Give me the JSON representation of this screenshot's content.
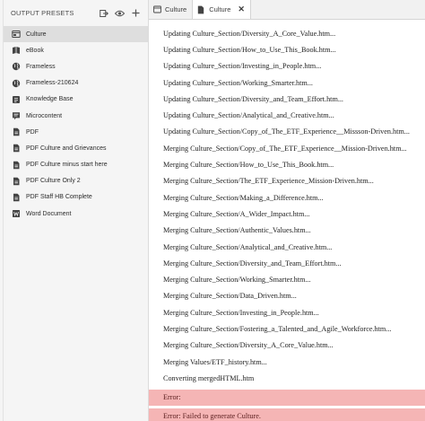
{
  "sidebar": {
    "title": "OUTPUT PRESETS",
    "presets": [
      {
        "label": "Culture",
        "icon": "web-icon",
        "selected": true
      },
      {
        "label": "eBook",
        "icon": "ebook-icon"
      },
      {
        "label": "Frameless",
        "icon": "globe-icon"
      },
      {
        "label": "Frameless-210624",
        "icon": "globe-icon"
      },
      {
        "label": "Knowledge Base",
        "icon": "knowledge-base-icon"
      },
      {
        "label": "Microcontent",
        "icon": "microcontent-icon"
      },
      {
        "label": "PDF",
        "icon": "pdf-icon"
      },
      {
        "label": "PDF Culture and Grievances",
        "icon": "pdf-icon"
      },
      {
        "label": "PDF Culture minus start here",
        "icon": "pdf-icon"
      },
      {
        "label": "PDF Culture Only 2",
        "icon": "pdf-icon"
      },
      {
        "label": "PDF Staff HB Complete",
        "icon": "pdf-icon"
      },
      {
        "label": "Word Document",
        "icon": "word-document-icon"
      }
    ]
  },
  "tabs": [
    {
      "label": "Culture",
      "icon": "preset-tab-icon",
      "active": false
    },
    {
      "label": "Culture",
      "icon": "document-tab-icon",
      "active": true,
      "close": "✕"
    }
  ],
  "log": [
    {
      "text": "Updating Culture_Section/Diversity_A_Core_Value.htm..."
    },
    {
      "text": "Updating Culture_Section/How_to_Use_This_Book.htm..."
    },
    {
      "text": "Updating Culture_Section/Investing_in_People.htm..."
    },
    {
      "text": "Updating Culture_Section/Working_Smarter.htm..."
    },
    {
      "text": "Updating Culture_Section/Diversity_and_Team_Effort.htm..."
    },
    {
      "text": "Updating Culture_Section/Analytical_and_Creative.htm..."
    },
    {
      "text": "Updating Culture_Section/Copy_of_The_ETF_Experience__Missson-Driven.htm..."
    },
    {
      "text": "Merging Culture_Section/Copy_of_The_ETF_Experience__Mission-Driven.htm..."
    },
    {
      "text": "Merging Culture_Section/How_to_Use_This_Book.htm..."
    },
    {
      "text": "Merging Culture_Section/The_ETF_Experience_Mission-Driven.htm..."
    },
    {
      "text": "Merging Culture_Section/Making_a_Difference.htm..."
    },
    {
      "text": "Merging Culture_Section/A_Wider_Impact.htm..."
    },
    {
      "text": "Merging Culture_Section/Authentic_Values.htm..."
    },
    {
      "text": "Merging Culture_Section/Analytical_and_Creative.htm..."
    },
    {
      "text": "Merging Culture_Section/Diversity_and_Team_Effort.htm..."
    },
    {
      "text": "Merging Culture_Section/Working_Smarter.htm..."
    },
    {
      "text": "Merging Culture_Section/Data_Driven.htm..."
    },
    {
      "text": "Merging Culture_Section/Investing_in_People.htm..."
    },
    {
      "text": "Merging Culture_Section/Fostering_a_Talented_and_Agile_Workforce.htm..."
    },
    {
      "text": "Merging Culture_Section/Diversity_A_Core_Value.htm..."
    },
    {
      "text": "Merging Values/ETF_history.htm..."
    },
    {
      "text": "Converting mergedHTML.htm"
    },
    {
      "text": "Error:",
      "error": true
    },
    {
      "text": "Error: Failed to generate Culture.",
      "error": true
    }
  ],
  "colors": {
    "error_background": "#f5b5b5",
    "selected_background": "#dedede",
    "sidebar_background": "#f5f5f5"
  }
}
